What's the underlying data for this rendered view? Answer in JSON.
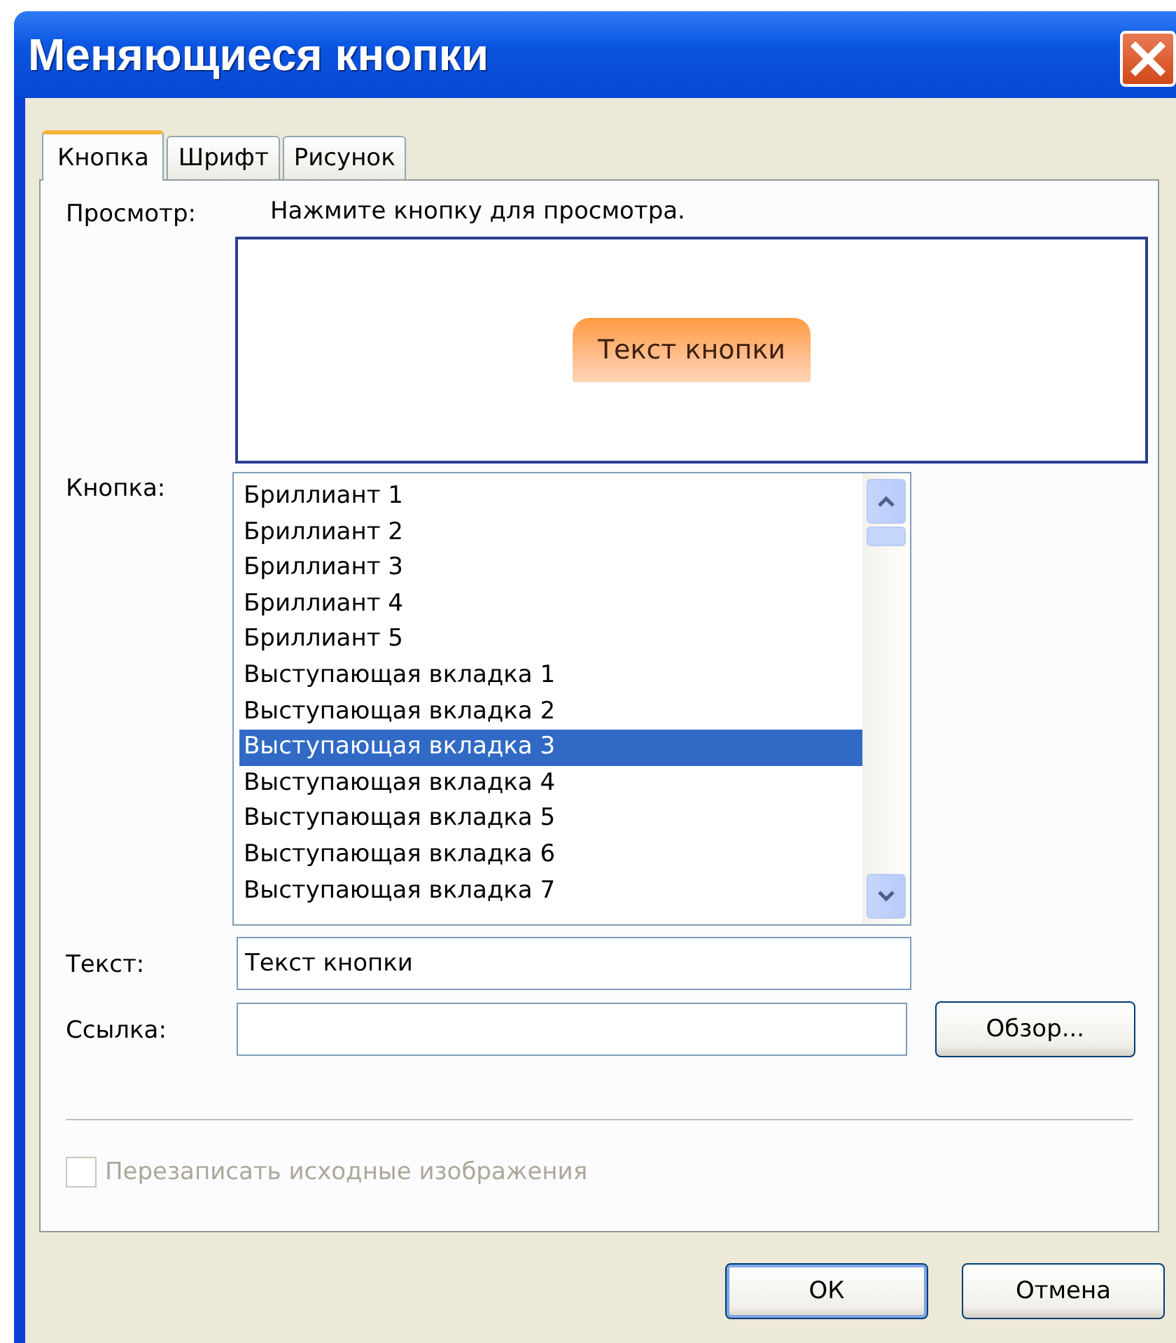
{
  "window": {
    "title": "Меняющиеся кнопки"
  },
  "tabs": [
    {
      "label": "Кнопка",
      "selected": true
    },
    {
      "label": "Шрифт",
      "selected": false
    },
    {
      "label": "Рисунок",
      "selected": false
    }
  ],
  "preview": {
    "label": "Просмотр:",
    "hint": "Нажмите кнопку для просмотра.",
    "button_text": "Текст кнопки"
  },
  "button_list": {
    "label": "Кнопка:",
    "items": [
      {
        "text": "Бриллиант 1",
        "selected": false
      },
      {
        "text": "Бриллиант 2",
        "selected": false
      },
      {
        "text": "Бриллиант 3",
        "selected": false
      },
      {
        "text": "Бриллиант 4",
        "selected": false
      },
      {
        "text": "Бриллиант 5",
        "selected": false
      },
      {
        "text": "Выступающая вкладка 1",
        "selected": false
      },
      {
        "text": "Выступающая вкладка 2",
        "selected": false
      },
      {
        "text": "Выступающая вкладка 3",
        "selected": true
      },
      {
        "text": "Выступающая вкладка 4",
        "selected": false
      },
      {
        "text": "Выступающая вкладка 5",
        "selected": false
      },
      {
        "text": "Выступающая вкладка 6",
        "selected": false
      },
      {
        "text": "Выступающая вкладка 7",
        "selected": false
      }
    ]
  },
  "text_field": {
    "label": "Текст:",
    "value": "Текст кнопки"
  },
  "link_field": {
    "label": "Ссылка:"
  },
  "browse_button": "Обзор...",
  "overwrite_checkbox": {
    "label": "Перезаписать исходные изображения",
    "checked": false,
    "disabled": true
  },
  "buttons": [
    {
      "label": "ОК",
      "kind": "default"
    },
    {
      "label": "Отмена",
      "kind": "normal"
    }
  ]
}
